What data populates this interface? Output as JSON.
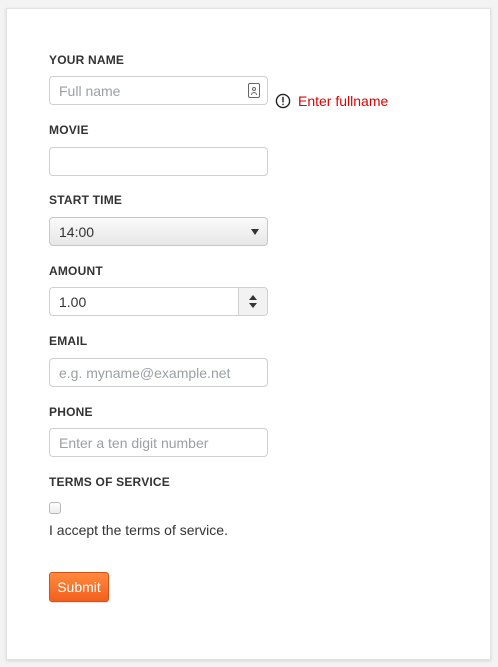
{
  "form": {
    "name": {
      "label": "YOUR NAME",
      "placeholder": "Full name",
      "icon": "contact-card-icon",
      "error_icon": "exclamation-circle-icon",
      "error_message": "Enter fullname"
    },
    "movie": {
      "label": "MOVIE",
      "value": ""
    },
    "start_time": {
      "label": "START TIME",
      "selected_value": "14:00"
    },
    "amount": {
      "label": "AMOUNT",
      "value": "1.00"
    },
    "email": {
      "label": "EMAIL",
      "placeholder": "e.g. myname@example.net"
    },
    "phone": {
      "label": "PHONE",
      "placeholder": "Enter a ten digit number"
    },
    "terms": {
      "label": "TERMS OF SERVICE",
      "text": "I accept the terms of service.",
      "checked": false
    },
    "submit_label": "Submit"
  },
  "colors": {
    "error": "#e00000",
    "submit": "#f37021",
    "text": "#333333",
    "border": "#cfcfcf"
  }
}
